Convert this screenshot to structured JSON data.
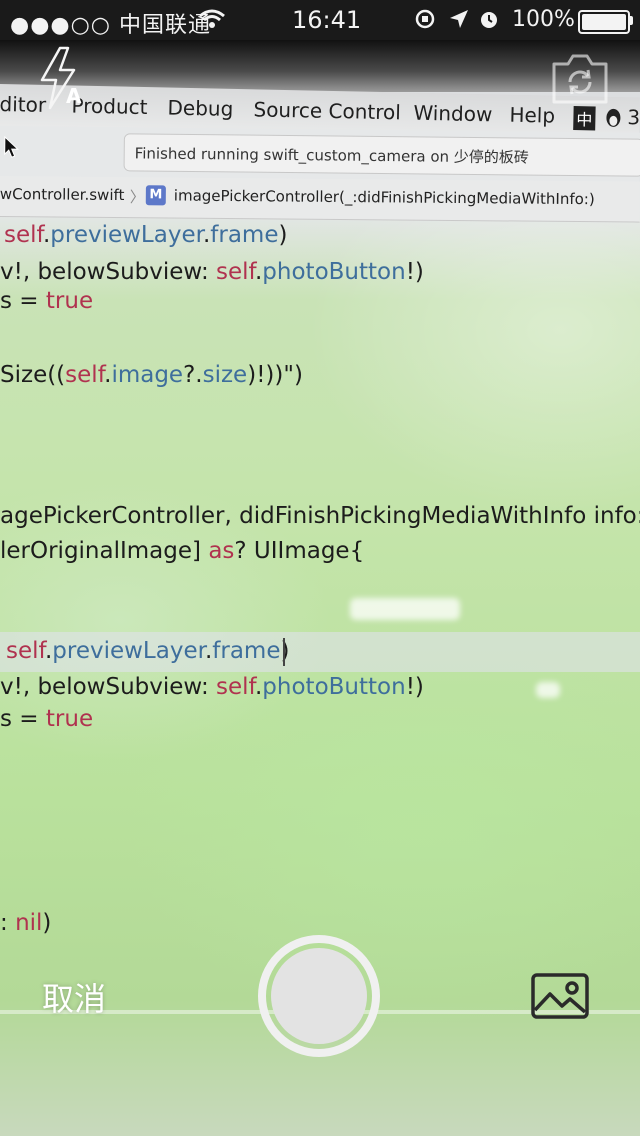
{
  "status_bar": {
    "carrier": "●●●○○ 中国联通",
    "time": "16:41",
    "battery_percent": "100%"
  },
  "camera_controls": {
    "flash_icon": "flash-auto-icon",
    "flash_mode_letter": "A",
    "switch_camera_icon": "camera-rotate-icon",
    "cancel_label": "取消",
    "shutter_icon": "shutter-icon",
    "gallery_icon": "photo-library-icon"
  },
  "viewfinder_scene": {
    "menubar": [
      "ditor",
      "Product",
      "Debug",
      "Source Control",
      "Window",
      "Help"
    ],
    "menubar_extra": [
      "中",
      "3"
    ],
    "activity_status": "Finished running swift_custom_camera on 少停的板砖",
    "jumpbar": {
      "file": "wController.swift",
      "separator": "〉",
      "method_badge": "M",
      "method": "imagePickerController(_:didFinishPickingMediaWithInfo:)"
    },
    "code_lines": [
      "self.previewLayer.frame)",
      "v!, belowSubview: self.photoButton!)",
      "s = true",
      "Size((self.image?.size)!))\")",
      "agePickerController, didFinishPickingMediaWithInfo info: [St",
      "lerOriginalImage] as? UIImage{",
      "self.previewLayer.frame)",
      "v!, belowSubview: self.photoButton!)",
      "s = true",
      ": nil)"
    ]
  },
  "colors": {
    "status_bar_bg": "#1a1a1a",
    "code_keyword": "#b0324f",
    "code_property": "#3e6e9c",
    "screen_tint": "#c4e4aa",
    "shutter": "#f0f0f0"
  }
}
